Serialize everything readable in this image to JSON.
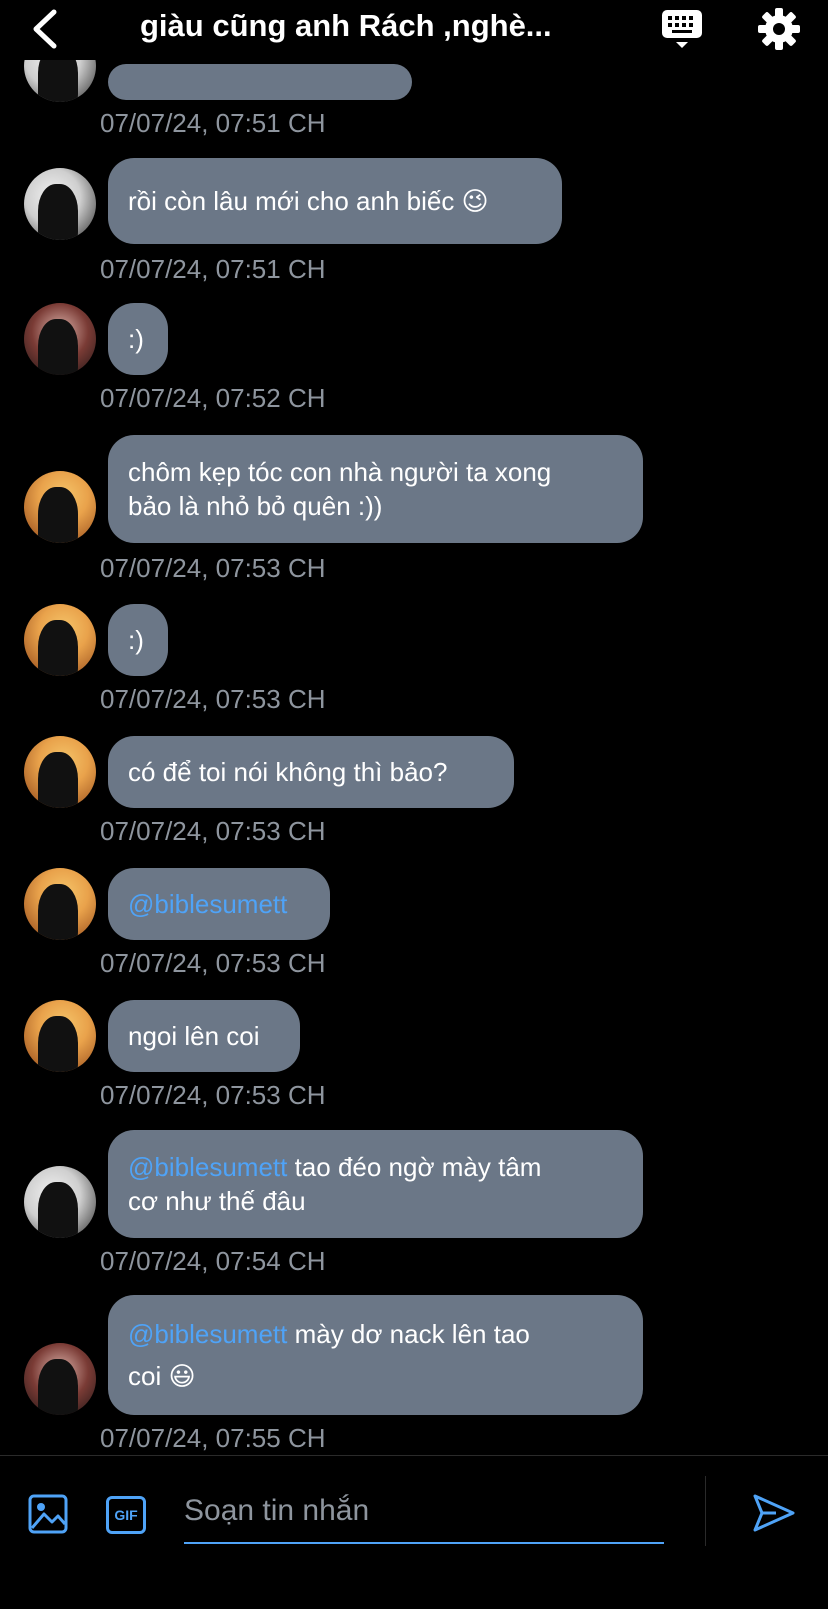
{
  "header": {
    "title": "giàu cũng anh Rách ,nghè..."
  },
  "messages": [
    {
      "avatar": "bw",
      "text": "",
      "time": "07/07/24, 07:51 CH"
    },
    {
      "avatar": "bw",
      "text": "rồi còn lâu mới cho anh biếc 😉",
      "time": "07/07/24, 07:51 CH"
    },
    {
      "avatar": "red",
      "text": ":)",
      "time": "07/07/24, 07:52 CH"
    },
    {
      "avatar": "sunset",
      "line1": "chôm kẹp tóc con nhà người ta xong",
      "line2": "bảo là nhỏ bỏ quên :))",
      "time": "07/07/24, 07:53 CH"
    },
    {
      "avatar": "sunset",
      "text": ":)",
      "time": "07/07/24, 07:53 CH"
    },
    {
      "avatar": "sunset",
      "text": "có để toi nói không thì bảo?",
      "time": "07/07/24, 07:53 CH"
    },
    {
      "avatar": "sunset",
      "mention": "@biblesumett",
      "time": "07/07/24, 07:53 CH"
    },
    {
      "avatar": "sunset",
      "text": "ngoi lên coi",
      "time": "07/07/24, 07:53 CH"
    },
    {
      "avatar": "bw",
      "mention": "@biblesumett",
      "line1": " tao đéo ngờ mày tâm",
      "line2": "cơ như thế đâu",
      "time": "07/07/24, 07:54 CH"
    },
    {
      "avatar": "red",
      "mention": "@biblesumett",
      "line1": " mày dơ nack lên tao",
      "line2": "coi 😃",
      "time": "07/07/24, 07:55 CH"
    }
  ],
  "composer": {
    "placeholder": "Soạn tin nhắn",
    "gif_label": "GIF"
  },
  "colors": {
    "bubble": "#6b7787",
    "accent": "#4fa3f7",
    "timestamp": "#8e959e"
  },
  "icons": [
    "chevron-left-icon",
    "keyboard-icon",
    "gear-icon",
    "image-icon",
    "gif-icon",
    "send-icon"
  ]
}
